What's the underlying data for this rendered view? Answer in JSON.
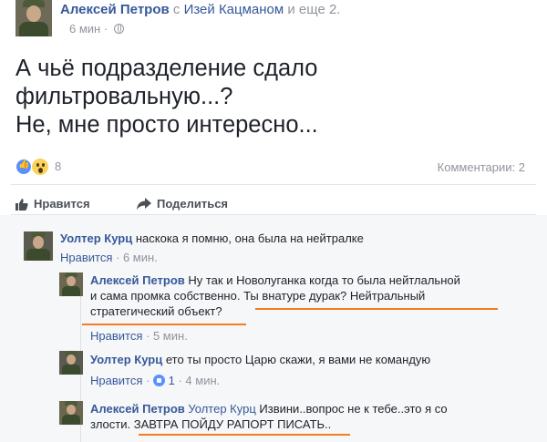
{
  "post": {
    "author": "Алексей Петров",
    "with_prefix": "с",
    "with_name": "Изей Кацманом",
    "and_more": "и еще 2.",
    "time": "6 мин",
    "separator": "·",
    "text_line1": "А чьё подразделение сдало",
    "text_line2": "фильтровальную...?",
    "text_line3": "Не, мне просто интересно...",
    "reactions_count": "8",
    "comments_label": "Комментарии: 2",
    "like_label": "Нравится",
    "share_label": "Поделиться"
  },
  "comments": [
    {
      "author": "Уолтер Курц",
      "text": "наскока я помню, она была на нейтралке",
      "like_label": "Нравится",
      "dot": "·",
      "time": "6 мин."
    }
  ],
  "replies": [
    {
      "author": "Алексей Петров",
      "text_line1": "Ну так и Новолуганка когда то была нейтлальной",
      "text_line2": "и сама промка собственно. Ты внатуре дурак? Нейтральный",
      "text_line3": "стратегический объект?",
      "like_label": "Нравится",
      "dot": "·",
      "time": "5 мин."
    },
    {
      "author": "Уолтер Курц",
      "text": "ето ты просто Царю скажи, я вами не командую",
      "like_label": "Нравится",
      "dot": "·",
      "likes": "1",
      "dot2": "·",
      "time": "4 мин."
    },
    {
      "author": "Алексей Петров",
      "mention": "Уолтер Курц",
      "text_line1": "Извини..вопрос не к тебе..это я со",
      "text_line2_a": "злости.",
      "text_line2_b": "ЗАВТРА ПОЙДУ РАПОРТ ПИСАТЬ",
      "text_line2_c": ".."
    }
  ],
  "colors": {
    "link": "#365899",
    "grey": "#90949c",
    "underline": "#f47b20",
    "comments_bg": "#f6f7f9"
  }
}
